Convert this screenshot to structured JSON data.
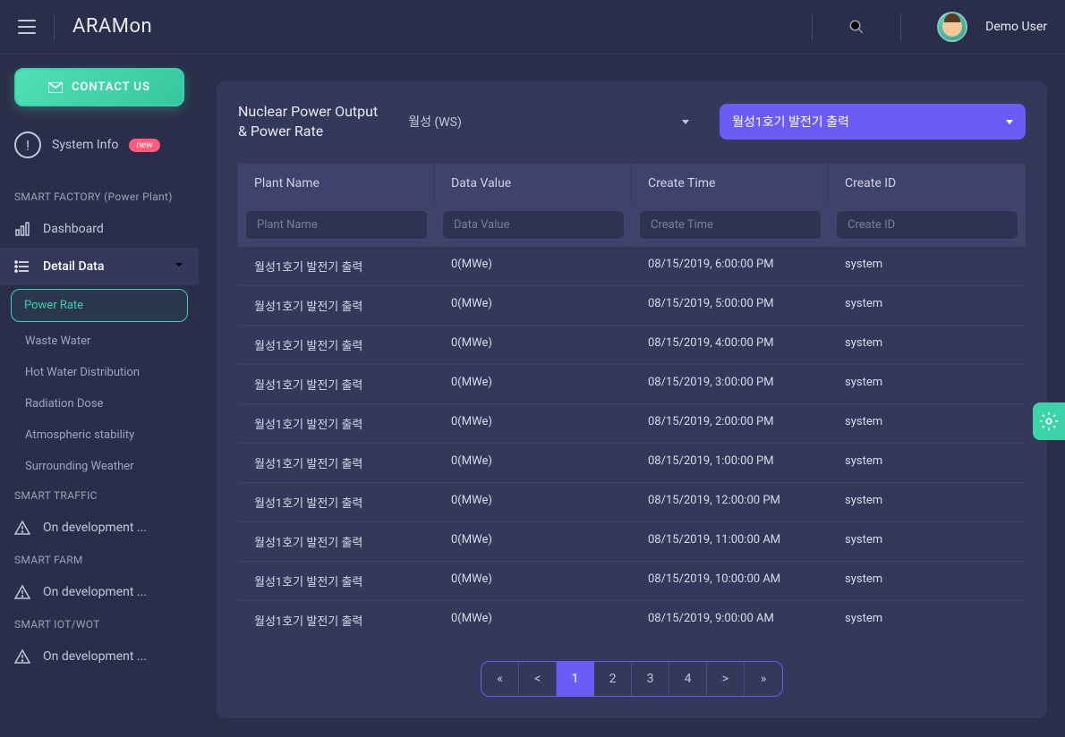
{
  "header": {
    "app_title": "ARAMon",
    "username": "Demo User"
  },
  "sidebar": {
    "contact_label": "CONTACT US",
    "system_info_label": "System Info",
    "badge_new": "new",
    "sections": [
      {
        "title": "SMART FACTORY (Power Plant)",
        "items": [
          {
            "label": "Dashboard",
            "icon": "dashboard"
          },
          {
            "label": "Detail Data",
            "icon": "list",
            "expanded": true
          }
        ],
        "sub_items": [
          {
            "label": "Power Rate",
            "active": true
          },
          {
            "label": "Waste Water"
          },
          {
            "label": "Hot Water Distribution"
          },
          {
            "label": "Radiation Dose"
          },
          {
            "label": "Atmospheric stability"
          },
          {
            "label": "Surrounding Weather"
          }
        ]
      },
      {
        "title": "SMART TRAFFIC",
        "items": [
          {
            "label": "On development ...",
            "icon": "warning"
          }
        ]
      },
      {
        "title": "SMART FARM",
        "items": [
          {
            "label": "On development ...",
            "icon": "warning"
          }
        ]
      },
      {
        "title": "SMART IOT/WOT",
        "items": [
          {
            "label": "On development ...",
            "icon": "warning"
          }
        ]
      }
    ]
  },
  "main": {
    "title_line1": "Nuclear Power Output",
    "title_line2": "& Power Rate",
    "select1": "월성 (WS)",
    "select2": "월성1호기 발전기 출력",
    "columns": [
      {
        "header": "Plant Name",
        "placeholder": "Plant Name"
      },
      {
        "header": "Data Value",
        "placeholder": "Data Value"
      },
      {
        "header": "Create Time",
        "placeholder": "Create Time"
      },
      {
        "header": "Create ID",
        "placeholder": "Create ID"
      }
    ],
    "rows": [
      {
        "plant": "월성1호기 발전기 출력",
        "value": "0(MWe)",
        "time": "08/15/2019, 6:00:00 PM",
        "id": "system"
      },
      {
        "plant": "월성1호기 발전기 출력",
        "value": "0(MWe)",
        "time": "08/15/2019, 5:00:00 PM",
        "id": "system"
      },
      {
        "plant": "월성1호기 발전기 출력",
        "value": "0(MWe)",
        "time": "08/15/2019, 4:00:00 PM",
        "id": "system"
      },
      {
        "plant": "월성1호기 발전기 출력",
        "value": "0(MWe)",
        "time": "08/15/2019, 3:00:00 PM",
        "id": "system"
      },
      {
        "plant": "월성1호기 발전기 출력",
        "value": "0(MWe)",
        "time": "08/15/2019, 2:00:00 PM",
        "id": "system"
      },
      {
        "plant": "월성1호기 발전기 출력",
        "value": "0(MWe)",
        "time": "08/15/2019, 1:00:00 PM",
        "id": "system"
      },
      {
        "plant": "월성1호기 발전기 출력",
        "value": "0(MWe)",
        "time": "08/15/2019, 12:00:00 PM",
        "id": "system"
      },
      {
        "plant": "월성1호기 발전기 출력",
        "value": "0(MWe)",
        "time": "08/15/2019, 11:00:00 AM",
        "id": "system"
      },
      {
        "plant": "월성1호기 발전기 출력",
        "value": "0(MWe)",
        "time": "08/15/2019, 10:00:00 AM",
        "id": "system"
      },
      {
        "plant": "월성1호기 발전기 출력",
        "value": "0(MWe)",
        "time": "08/15/2019, 9:00:00 AM",
        "id": "system"
      }
    ],
    "pagination": {
      "first": "«",
      "prev": "<",
      "pages": [
        "1",
        "2",
        "3",
        "4"
      ],
      "next": ">",
      "last": "»",
      "active": "1"
    }
  }
}
